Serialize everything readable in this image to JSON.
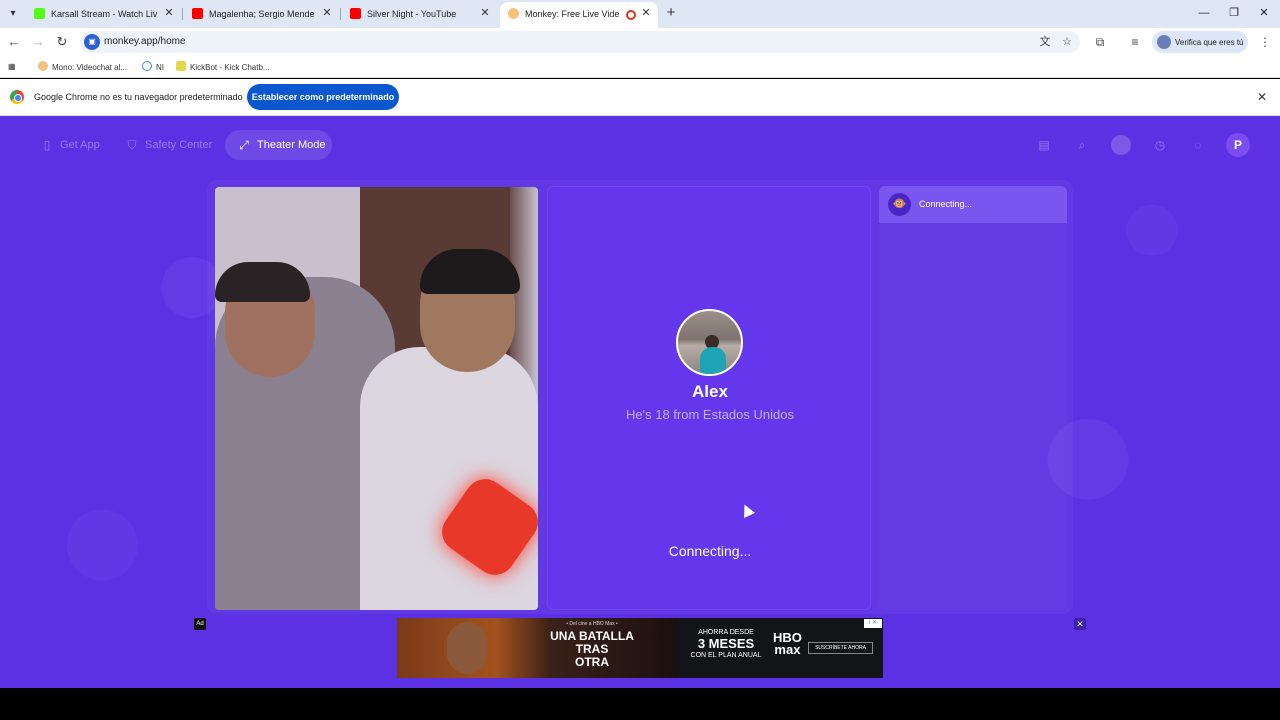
{
  "browser": {
    "tabs": [
      {
        "title": "Karsall Stream - Watch Live on",
        "favicon_color": "#53fc18"
      },
      {
        "title": "Magalenha; Sergio Mendes [Le",
        "favicon_color": "#ff0000"
      },
      {
        "title": "Silver Night - YouTube",
        "favicon_color": "#ff0000"
      },
      {
        "title": "Monkey: Free Live Video Ch",
        "favicon_color": "#f4c27a"
      }
    ],
    "url": "monkey.app/home",
    "profile_label": "Verifica que eres tú",
    "bookmarks": [
      {
        "label": "Mono: Videochat al..."
      },
      {
        "label": "NI"
      },
      {
        "label": "KickBot - Kick Chatb..."
      }
    ],
    "infobar": {
      "message": "Google Chrome no es tu navegador predeterminado",
      "button": "Establecer como predeterminado"
    }
  },
  "monkey": {
    "nav": {
      "get_app": "Get App",
      "safety_center": "Safety Center",
      "theater_mode": "Theater Mode"
    },
    "user_initial": "P",
    "match": {
      "name": "Alex",
      "description": "He's 18 from Estados Unidos",
      "status": "Connecting..."
    },
    "chat": {
      "status": "Connecting..."
    },
    "colors": {
      "background": "#5c30e3",
      "panel": "#6436ec"
    }
  },
  "ad": {
    "badge": "Ad",
    "top_line": "• Del cine a HBO Max •",
    "title": "UNA BATALLA\nTRAS\nOTRA",
    "promo_line1": "AHORRA DESDE",
    "promo_big": "3 MESES",
    "promo_line2": "CON EL PLAN ANUAL",
    "logo": "HBO\nmax",
    "cta": "SUSCRÍBETE AHORA"
  }
}
